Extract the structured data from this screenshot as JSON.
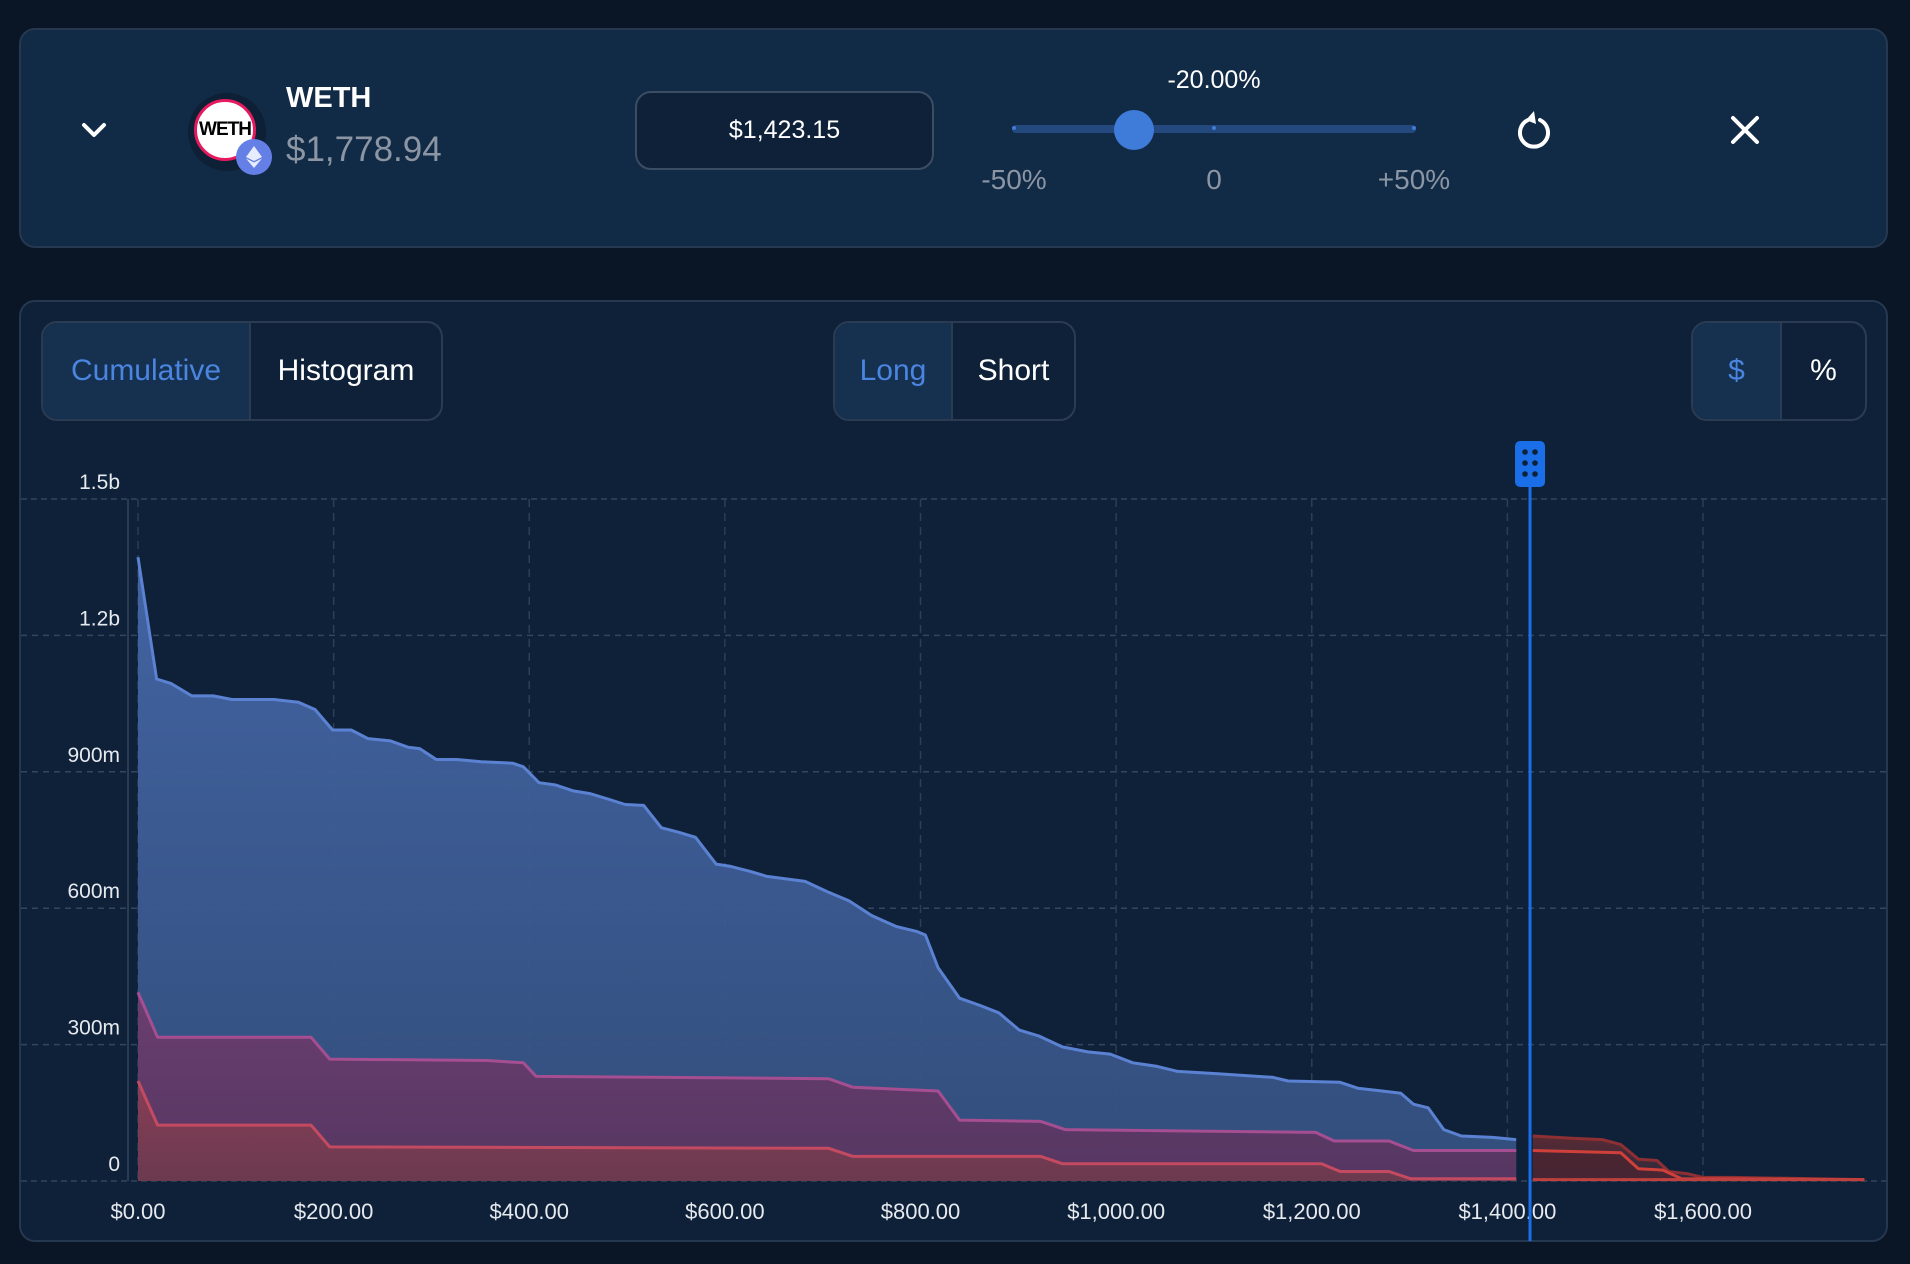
{
  "token": {
    "symbol": "WETH",
    "price": "$1,778.94",
    "logo_text": "WETH",
    "chain_icon": "ethereum-icon"
  },
  "target_price_input": {
    "value": "$1,423.15"
  },
  "slider": {
    "value_label": "-20.00%",
    "value_percent": -20,
    "min_label": "-50%",
    "mid_label": "0",
    "max_label": "+50%",
    "min": -50,
    "max": 50
  },
  "icons": {
    "collapse": "chevron-down-icon",
    "reset": "reset-icon",
    "close": "close-icon"
  },
  "view_toggle": {
    "options": [
      "Cumulative",
      "Histogram"
    ],
    "selected": "Cumulative"
  },
  "side_toggle": {
    "options": [
      "Long",
      "Short"
    ],
    "selected": "Long"
  },
  "unit_toggle": {
    "options": [
      "$",
      "%"
    ],
    "selected": "$"
  },
  "colors": {
    "accent": "#3f7bd8",
    "price_line": "#1a6fe8",
    "long_total": "#4a6cb0",
    "long_mid": "#7a3d72",
    "long_low": "#8a3a50",
    "short": "#c0403e"
  },
  "chart_data": {
    "type": "area",
    "ylim": [
      0,
      1500
    ],
    "xlim": [
      0,
      1780
    ],
    "y_ticks": [
      {
        "v": 0,
        "label": "0"
      },
      {
        "v": 300,
        "label": "300m"
      },
      {
        "v": 600,
        "label": "600m"
      },
      {
        "v": 900,
        "label": "900m"
      },
      {
        "v": 1200,
        "label": "1.2b"
      },
      {
        "v": 1500,
        "label": "1.5b"
      }
    ],
    "x_ticks": [
      {
        "v": 0,
        "label": "$0.00"
      },
      {
        "v": 200,
        "label": "$200.00"
      },
      {
        "v": 400,
        "label": "$400.00"
      },
      {
        "v": 600,
        "label": "$600.00"
      },
      {
        "v": 800,
        "label": "$800.00"
      },
      {
        "v": 1000,
        "label": "$1,000.00"
      },
      {
        "v": 1200,
        "label": "$1,200.00"
      },
      {
        "v": 1400,
        "label": "$1,400.00"
      },
      {
        "v": 1600,
        "label": "$1,600.00"
      }
    ],
    "grid": true,
    "current_price_marker": 1423.15,
    "series": [
      {
        "side": "long",
        "layer": "total",
        "points": [
          [
            0,
            1372
          ],
          [
            19,
            1104
          ],
          [
            34,
            1094
          ],
          [
            55,
            1067
          ],
          [
            77,
            1067
          ],
          [
            96,
            1059
          ],
          [
            139,
            1059
          ],
          [
            164,
            1053
          ],
          [
            181,
            1037
          ],
          [
            199,
            992
          ],
          [
            218,
            992
          ],
          [
            235,
            973
          ],
          [
            258,
            968
          ],
          [
            276,
            954
          ],
          [
            288,
            951
          ],
          [
            305,
            927
          ],
          [
            326,
            927
          ],
          [
            351,
            922
          ],
          [
            383,
            919
          ],
          [
            394,
            911
          ],
          [
            410,
            876
          ],
          [
            427,
            871
          ],
          [
            445,
            858
          ],
          [
            462,
            852
          ],
          [
            482,
            839
          ],
          [
            498,
            828
          ],
          [
            517,
            826
          ],
          [
            535,
            777
          ],
          [
            553,
            767
          ],
          [
            570,
            756
          ],
          [
            591,
            697
          ],
          [
            606,
            692
          ],
          [
            626,
            681
          ],
          [
            643,
            670
          ],
          [
            682,
            659
          ],
          [
            706,
            635
          ],
          [
            727,
            616
          ],
          [
            750,
            584
          ],
          [
            775,
            560
          ],
          [
            796,
            549
          ],
          [
            805,
            541
          ],
          [
            818,
            469
          ],
          [
            840,
            402
          ],
          [
            861,
            386
          ],
          [
            880,
            370
          ],
          [
            901,
            332
          ],
          [
            921,
            319
          ],
          [
            945,
            295
          ],
          [
            971,
            284
          ],
          [
            994,
            279
          ],
          [
            1017,
            260
          ],
          [
            1042,
            252
          ],
          [
            1063,
            241
          ],
          [
            1104,
            236
          ],
          [
            1160,
            228
          ],
          [
            1176,
            220
          ],
          [
            1229,
            217
          ],
          [
            1247,
            204
          ],
          [
            1272,
            198
          ],
          [
            1291,
            193
          ],
          [
            1304,
            169
          ],
          [
            1319,
            161
          ],
          [
            1335,
            113
          ],
          [
            1353,
            99
          ],
          [
            1385,
            96
          ],
          [
            1409,
            91
          ]
        ]
      },
      {
        "side": "long",
        "layer": "mid",
        "points": [
          [
            0,
            415
          ],
          [
            20,
            316
          ],
          [
            177,
            316
          ],
          [
            196,
            268
          ],
          [
            357,
            265
          ],
          [
            394,
            260
          ],
          [
            407,
            230
          ],
          [
            706,
            225
          ],
          [
            731,
            206
          ],
          [
            818,
            198
          ],
          [
            840,
            134
          ],
          [
            923,
            131
          ],
          [
            948,
            113
          ],
          [
            1204,
            107
          ],
          [
            1223,
            88
          ],
          [
            1279,
            88
          ],
          [
            1304,
            67
          ],
          [
            1409,
            67
          ]
        ]
      },
      {
        "side": "long",
        "layer": "low",
        "points": [
          [
            0,
            220
          ],
          [
            20,
            123
          ],
          [
            177,
            123
          ],
          [
            196,
            75
          ],
          [
            706,
            72
          ],
          [
            731,
            54
          ],
          [
            923,
            54
          ],
          [
            945,
            38
          ],
          [
            1210,
            38
          ],
          [
            1229,
            21
          ],
          [
            1279,
            21
          ],
          [
            1301,
            5
          ],
          [
            1409,
            5
          ]
        ]
      },
      {
        "side": "short",
        "layer": "total",
        "points": [
          [
            1426,
            99
          ],
          [
            1466,
            94
          ],
          [
            1497,
            91
          ],
          [
            1516,
            80
          ],
          [
            1534,
            48
          ],
          [
            1553,
            45
          ],
          [
            1565,
            21
          ],
          [
            1584,
            16
          ],
          [
            1600,
            8
          ],
          [
            1628,
            8
          ],
          [
            1765,
            3
          ]
        ]
      },
      {
        "side": "short",
        "layer": "mid",
        "points": [
          [
            1426,
            67
          ],
          [
            1516,
            62
          ],
          [
            1534,
            27
          ],
          [
            1559,
            24
          ],
          [
            1578,
            5
          ],
          [
            1765,
            3
          ]
        ]
      },
      {
        "side": "short",
        "layer": "low",
        "points": [
          [
            1426,
            3
          ],
          [
            1765,
            3
          ]
        ]
      }
    ]
  }
}
